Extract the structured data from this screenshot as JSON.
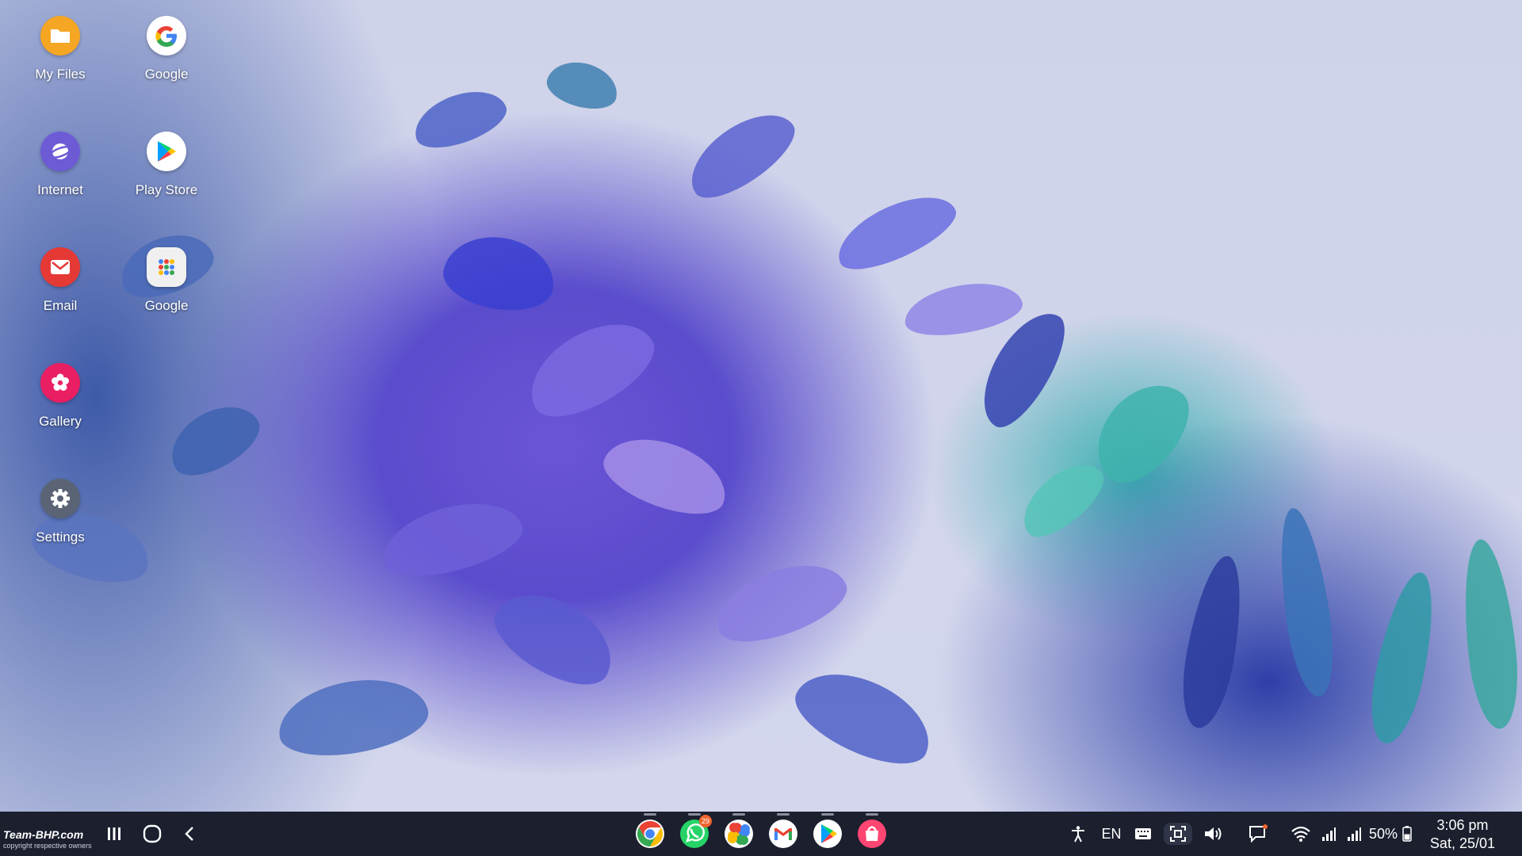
{
  "desktop": {
    "icons": [
      {
        "label": "My Files",
        "icon": "folder-icon",
        "color": "#f5a623"
      },
      {
        "label": "Google",
        "icon": "google-g-icon",
        "color": "#ffffff"
      },
      {
        "label": "Internet",
        "icon": "internet-planet-icon",
        "color": "#6d5bd6"
      },
      {
        "label": "Play Store",
        "icon": "play-store-icon",
        "color": "#ffffff"
      },
      {
        "label": "Email",
        "icon": "email-envelope-icon",
        "color": "#e53935"
      },
      {
        "label": "Google",
        "icon": "google-folder-icon",
        "color": "#f0f0f0"
      },
      {
        "label": "Gallery",
        "icon": "gallery-flower-icon",
        "color": "#e91e63"
      },
      {
        "label": "Settings",
        "icon": "gear-icon",
        "color": "#5b6475"
      }
    ]
  },
  "taskbar": {
    "background": "#1b1f2e",
    "nav": [
      "recent-apps-icon",
      "home-icon",
      "back-icon"
    ],
    "dock": [
      {
        "name": "chrome",
        "icon": "chrome-icon"
      },
      {
        "name": "whatsapp",
        "icon": "whatsapp-icon",
        "badge": "29"
      },
      {
        "name": "photos",
        "icon": "google-photos-icon"
      },
      {
        "name": "gmail",
        "icon": "gmail-icon"
      },
      {
        "name": "play-store",
        "icon": "play-store-icon"
      },
      {
        "name": "galaxy-store",
        "icon": "galaxy-store-bag-icon"
      }
    ],
    "tray": {
      "language": "EN",
      "battery": "50%",
      "time": "3:06 pm",
      "date": "Sat, 25/01"
    }
  },
  "watermark": {
    "text": "Team-BHP.com",
    "sub": "copyright respective owners"
  }
}
